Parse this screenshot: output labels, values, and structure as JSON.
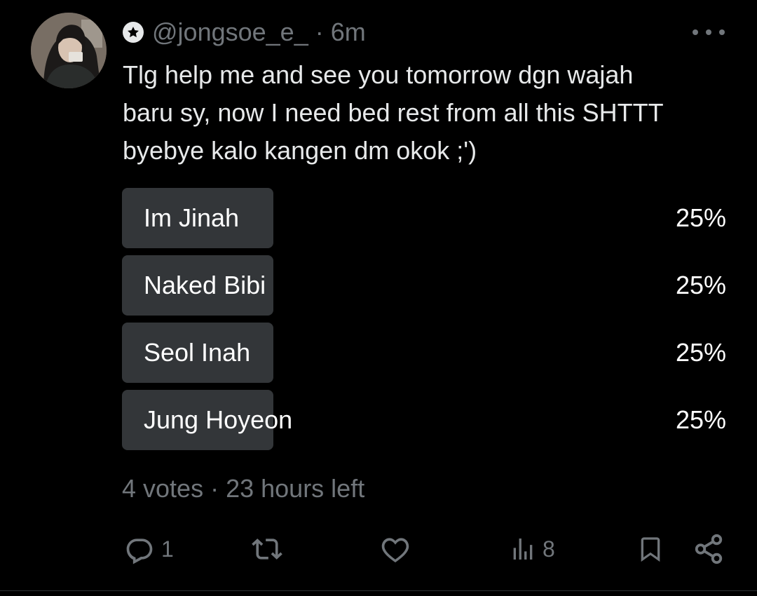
{
  "tweet": {
    "handle": "@jongsoe_e_",
    "separator": "·",
    "time": "6m",
    "text_lines": [
      "Tlg help me and see you tomorrow dgn wajah",
      "baru sy, now I need bed rest from all this SHTTT",
      "byebye kalo kangen dm okok ;')"
    ]
  },
  "poll": {
    "options": [
      {
        "label": "Im Jinah",
        "percent_text": "25%",
        "percent": 25
      },
      {
        "label": "Naked Bibi",
        "percent_text": "25%",
        "percent": 25
      },
      {
        "label": "Seol Inah",
        "percent_text": "25%",
        "percent": 25
      },
      {
        "label": "Jung Hoyeon",
        "percent_text": "25%",
        "percent": 25
      }
    ],
    "votes": "4 votes",
    "separator": "·",
    "time_left": "23 hours left"
  },
  "actions": {
    "replies": "1",
    "views": "8"
  },
  "colors": {
    "background": "#000000",
    "text": "#e7e9ea",
    "secondary": "#71767b",
    "poll_bar": "#333639"
  }
}
